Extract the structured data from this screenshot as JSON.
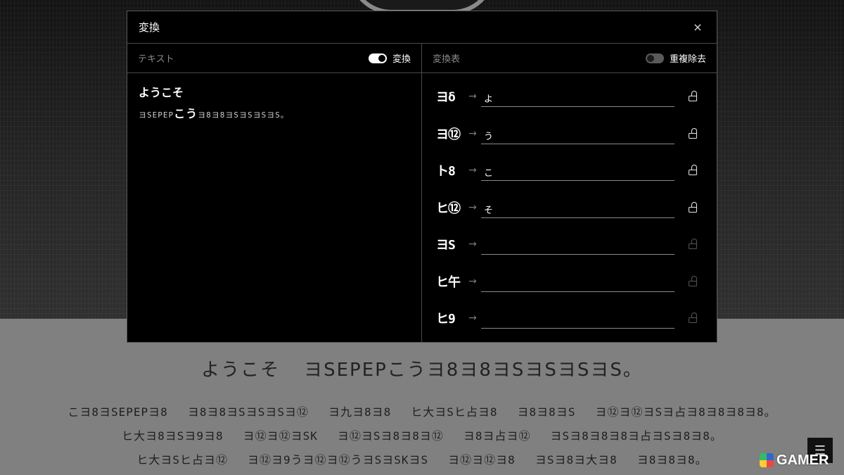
{
  "modal": {
    "title": "変換",
    "close_label": "×"
  },
  "left_pane": {
    "label": "テキスト",
    "toggle_label": "変換",
    "toggle_on": true,
    "text": "ようこそ",
    "converted_prefix": "ヨSEPEP",
    "converted_highlight": "こう",
    "converted_suffix": "ヨ8ヨ8ヨSヨSヨSヨS。"
  },
  "right_pane": {
    "label": "変換表",
    "toggle_label": "重複除去",
    "toggle_on": false,
    "mappings": [
      {
        "glyph": "ヨδ",
        "value": "よ",
        "locked": true
      },
      {
        "glyph": "ヨ⑫",
        "value": "う",
        "locked": true
      },
      {
        "glyph": "ト8",
        "value": "こ",
        "locked": true
      },
      {
        "glyph": "ヒ⑫",
        "value": "そ",
        "locked": true
      },
      {
        "glyph": "ヨS",
        "value": "",
        "locked": false
      },
      {
        "glyph": "ヒ午",
        "value": "",
        "locked": false
      },
      {
        "glyph": "ヒ9",
        "value": "",
        "locked": false
      }
    ]
  },
  "background": {
    "heading_text": "ようこそ",
    "heading_glyphs": "ヨSEPEPこうヨ8ヨ8ヨSヨSヨSヨS。",
    "lines": [
      [
        "こヨ8ヨSEPEPヨ8",
        "ヨ8ヨ8ヨSヨSヨSヨ⑫",
        "ヨ九ヨ8ヨ8",
        "ヒ大ヨSヒ占ヨ8",
        "ヨ8ヨ8ヨS",
        "ヨ⑫ヨ⑫ヨSヨ占ヨ8ヨ8ヨ8ヨ8。"
      ],
      [
        "ヒ大ヨ8ヨSヨ9ヨ8",
        "ヨ⑫ヨ⑫ヨSK",
        "ヨ⑫ヨSヨ8ヨ8ヨ⑫",
        "ヨ8ヨ占ヨ⑫",
        "ヨSヨ8ヨ8ヨ8ヨ占ヨSヨ8ヨ8。"
      ],
      [
        "ヒ大ヨSヒ占ヨ⑫",
        "ヨ⑫ヨ9うヨ⑫ヨ⑫うヨSヨSKヨS",
        "ヨ⑫ヨ⑫ヨ8",
        "ヨSヨ8ヨ大ヨ8",
        "ヨ8ヨ8ヨ8。"
      ]
    ],
    "menu_icon": "☰",
    "watermark": "GAMER"
  }
}
